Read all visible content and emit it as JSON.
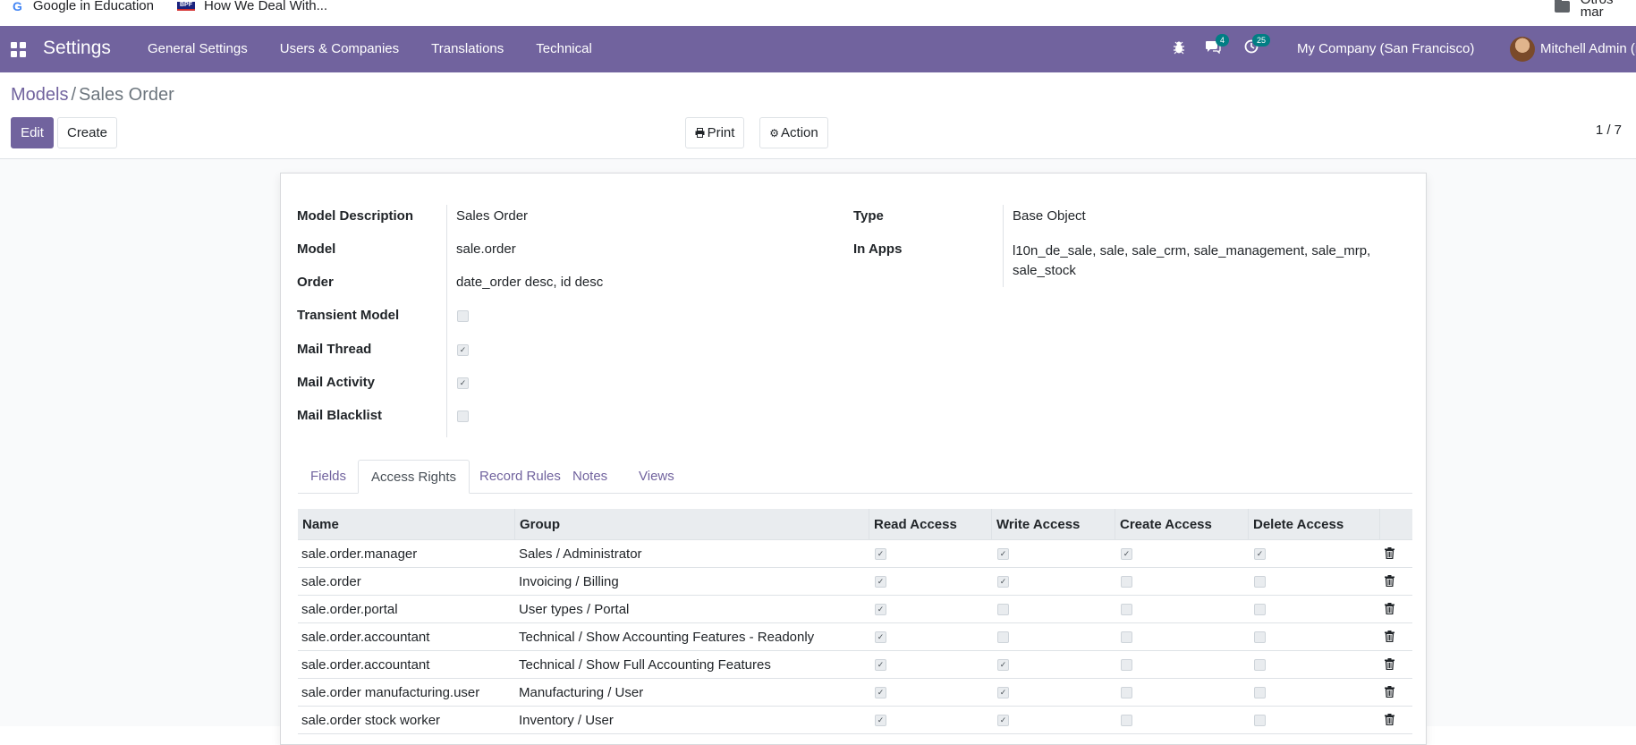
{
  "bookmarks": [
    {
      "label": "Google in Education",
      "icon": "google-icon"
    },
    {
      "label": "How We Deal With...",
      "icon": "bpf-icon"
    },
    {
      "label": "Otros mar",
      "icon": "folder-icon"
    }
  ],
  "bpf_logo_text": "BPF",
  "navbar": {
    "brand": "Settings",
    "menu": [
      "General Settings",
      "Users & Companies",
      "Translations",
      "Technical"
    ],
    "chat_badge": "4",
    "activity_badge": "25",
    "company": "My Company (San Francisco)",
    "user": "Mitchell Admin (m"
  },
  "breadcrumb": {
    "parent": "Models",
    "separator": "/",
    "current": "Sales Order"
  },
  "buttons": {
    "edit": "Edit",
    "create": "Create",
    "print": "Print",
    "action": "Action"
  },
  "pager": "1 / 7",
  "form": {
    "left": [
      {
        "label": "Model Description",
        "value": "Sales Order"
      },
      {
        "label": "Model",
        "value": "sale.order"
      },
      {
        "label": "Order",
        "value": "date_order desc, id desc"
      },
      {
        "label": "Transient Model",
        "checked": false
      },
      {
        "label": "Mail Thread",
        "checked": true
      },
      {
        "label": "Mail Activity",
        "checked": true
      },
      {
        "label": "Mail Blacklist",
        "checked": false
      }
    ],
    "right": [
      {
        "label": "Type",
        "value": "Base Object"
      },
      {
        "label": "In Apps",
        "value_line1": "l10n_de_sale, sale, sale_crm, sale_management, sale_mrp,",
        "value_line2": "sale_stock"
      }
    ]
  },
  "tabs": [
    "Fields",
    "Access Rights",
    "Record Rules",
    "Notes",
    "Views"
  ],
  "table": {
    "headers": [
      "Name",
      "Group",
      "Read Access",
      "Write Access",
      "Create Access",
      "Delete Access"
    ],
    "rows": [
      {
        "name": "sale.order.manager",
        "group": "Sales / Administrator",
        "read": true,
        "write": true,
        "create": true,
        "delete": true
      },
      {
        "name": "sale.order",
        "group": "Invoicing / Billing",
        "read": true,
        "write": true,
        "create": false,
        "delete": false
      },
      {
        "name": "sale.order.portal",
        "group": "User types / Portal",
        "read": true,
        "write": false,
        "create": false,
        "delete": false
      },
      {
        "name": "sale.order.accountant",
        "group": "Technical / Show Accounting Features - Readonly",
        "read": true,
        "write": false,
        "create": false,
        "delete": false
      },
      {
        "name": "sale.order.accountant",
        "group": "Technical / Show Full Accounting Features",
        "read": true,
        "write": true,
        "create": false,
        "delete": false
      },
      {
        "name": "sale.order manufacturing.user",
        "group": "Manufacturing / User",
        "read": true,
        "write": true,
        "create": false,
        "delete": false
      },
      {
        "name": "sale.order stock worker",
        "group": "Inventory / User",
        "read": true,
        "write": true,
        "create": false,
        "delete": false
      }
    ]
  },
  "colors": {
    "brand": "#71639e",
    "badge": "#017e84"
  }
}
